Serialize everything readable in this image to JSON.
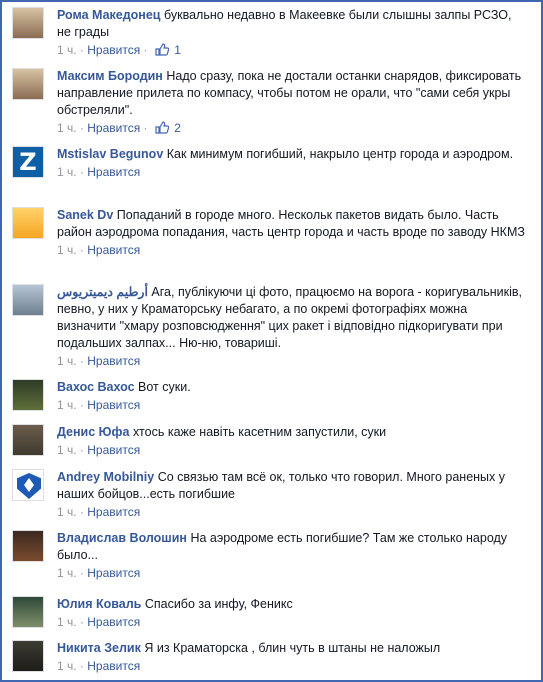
{
  "like_label": "Нравится",
  "comments": [
    {
      "name": "Рома Македонец",
      "text": "буквально недавно в Макеевке были слышны залпы РСЗО, не грады",
      "time": "1 ч.",
      "likes": "1",
      "avatar": "face"
    },
    {
      "name": "Максим Бородин",
      "text": "Надо сразу, пока не достали останки снарядов, фиксировать направление прилета по компасу, чтобы потом не орали, что \"сами себя укры обстреляли\".",
      "time": "1 ч.",
      "likes": "2",
      "avatar": "face"
    },
    {
      "name": "Mstislav Begunov",
      "text": "Как минимум погибший, накрыло центр города и аэродром.",
      "time": "1 ч.",
      "likes": "",
      "avatar": "z"
    },
    {
      "name": "Sanek Dv",
      "text": "Попаданий в городе много. Нескольк пакетов видать было. Часть район аэродрома попадания, часть центр города и часть вроде по заводу НКМЗ",
      "time": "1 ч.",
      "likes": "",
      "avatar": "sanek"
    },
    {
      "name": "أرطيم ديميتريوس",
      "text": "Ага, публікуючи ці фото, працюємо на ворога - коригувальників, певно, у них у Краматорську небагато, а по окремі фотографіях можна визначити \"хмару розповсюдження\" цих ракет і відповідно підкоригувати при подальших залпах... Ню-ню, товариші.",
      "time": "1 ч.",
      "likes": "",
      "avatar": "sky"
    },
    {
      "name": "Вахос Вахос",
      "text": "Вот суки.",
      "time": "1 ч.",
      "likes": "",
      "avatar": "green"
    },
    {
      "name": "Денис Юфа",
      "text": "хтось каже навіть касетним запустили, суки",
      "time": "1 ч.",
      "likes": "",
      "avatar": "kid"
    },
    {
      "name": "Andrey Mobilniy",
      "text": "Со связью там всё ок, только что говорил. Много раненых у наших бойцов...есть погибшие",
      "time": "1 ч.",
      "likes": "",
      "avatar": "dynamo"
    },
    {
      "name": "Владислав Волошин",
      "text": "На аэродроме есть погибшие? Там же столько народу было...",
      "time": "1 ч.",
      "likes": "",
      "avatar": "crowd"
    },
    {
      "name": "Юлия Коваль",
      "text": "Спасибо за инфу, Феникс",
      "time": "1 ч.",
      "likes": "",
      "avatar": "yulia"
    },
    {
      "name": "Никита Зелик",
      "text": "Я из Краматорска , блин чуть в штаны не наложыл",
      "time": "1 ч.",
      "likes": "",
      "avatar": "duo"
    }
  ]
}
